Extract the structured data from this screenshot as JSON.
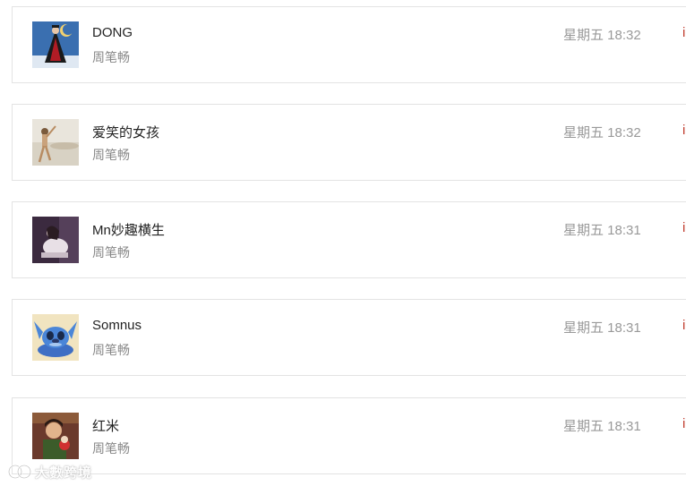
{
  "feed": {
    "items": [
      {
        "name": "DONG",
        "author": "周笔畅",
        "time": "星期五 18:32",
        "avatar_icon": "avatar-dong-icon"
      },
      {
        "name": "爱笑的女孩",
        "author": "周笔畅",
        "time": "星期五 18:32",
        "avatar_icon": "avatar-girl-beach-icon"
      },
      {
        "name": "Mn妙趣横生",
        "author": "周笔畅",
        "time": "星期五 18:31",
        "avatar_icon": "avatar-mn-icon"
      },
      {
        "name": "Somnus",
        "author": "周笔畅",
        "time": "星期五 18:31",
        "avatar_icon": "avatar-stitch-icon"
      },
      {
        "name": "红米",
        "author": "周笔畅",
        "time": "星期五 18:31",
        "avatar_icon": "avatar-hongmi-icon"
      }
    ]
  },
  "edge_action_glyph": "i",
  "watermark": {
    "logo_icon": "watermark-logo-icon",
    "text": "大數跨境"
  },
  "colors": {
    "name": "#222222",
    "author": "#888888",
    "time": "#999999",
    "border": "#e3e3e3",
    "edge_action": "#c0392b"
  }
}
